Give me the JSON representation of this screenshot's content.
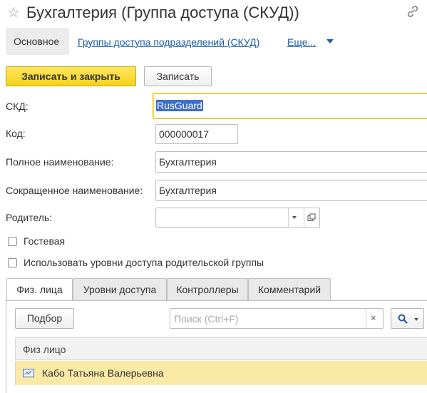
{
  "window": {
    "title": "Бухгалтерия (Группа доступа (СКУД))",
    "favorite_icon": "star-icon",
    "link_icon": "link-icon"
  },
  "nav": {
    "main_tab": "Основное",
    "link1": "Группы доступа подразделений (СКУД)",
    "more": "Еще..."
  },
  "toolbar": {
    "save_close": "Записать и закрыть",
    "save": "Записать"
  },
  "form": {
    "skd_label": "СКД:",
    "skd_value": "RusGuard",
    "code_label": "Код:",
    "code_value": "000000017",
    "fullname_label": "Полное наименование:",
    "fullname_value": "Бухгалтерия",
    "shortname_label": "Сокращенное наименование:",
    "shortname_value": "Бухгалтерия",
    "parent_label": "Родитель:",
    "parent_value": "",
    "guest_label": "Гостевая",
    "guest_checked": false,
    "use_parent_label": "Использовать уровни доступа родительской группы",
    "use_parent_checked": false
  },
  "tabs": [
    {
      "label": "Физ. лица",
      "active": true
    },
    {
      "label": "Уровни доступа",
      "active": false
    },
    {
      "label": "Контроллеры",
      "active": false
    },
    {
      "label": "Комментарий",
      "active": false
    }
  ],
  "table": {
    "pick_button": "Подбор",
    "search_placeholder": "Поиск (Ctrl+F)",
    "clear_icon": "close-icon",
    "search_icon": "magnifier-icon",
    "column_header": "Физ лицо",
    "rows": [
      {
        "icon": "person-card-icon",
        "name": "Кабо Татьяна Валерьевна"
      }
    ]
  },
  "colors": {
    "accent_yellow": "#f6d21a",
    "link_blue": "#1a5bab",
    "row_highlight": "#fbe9a6",
    "selection_blue": "#3e6ecb"
  }
}
